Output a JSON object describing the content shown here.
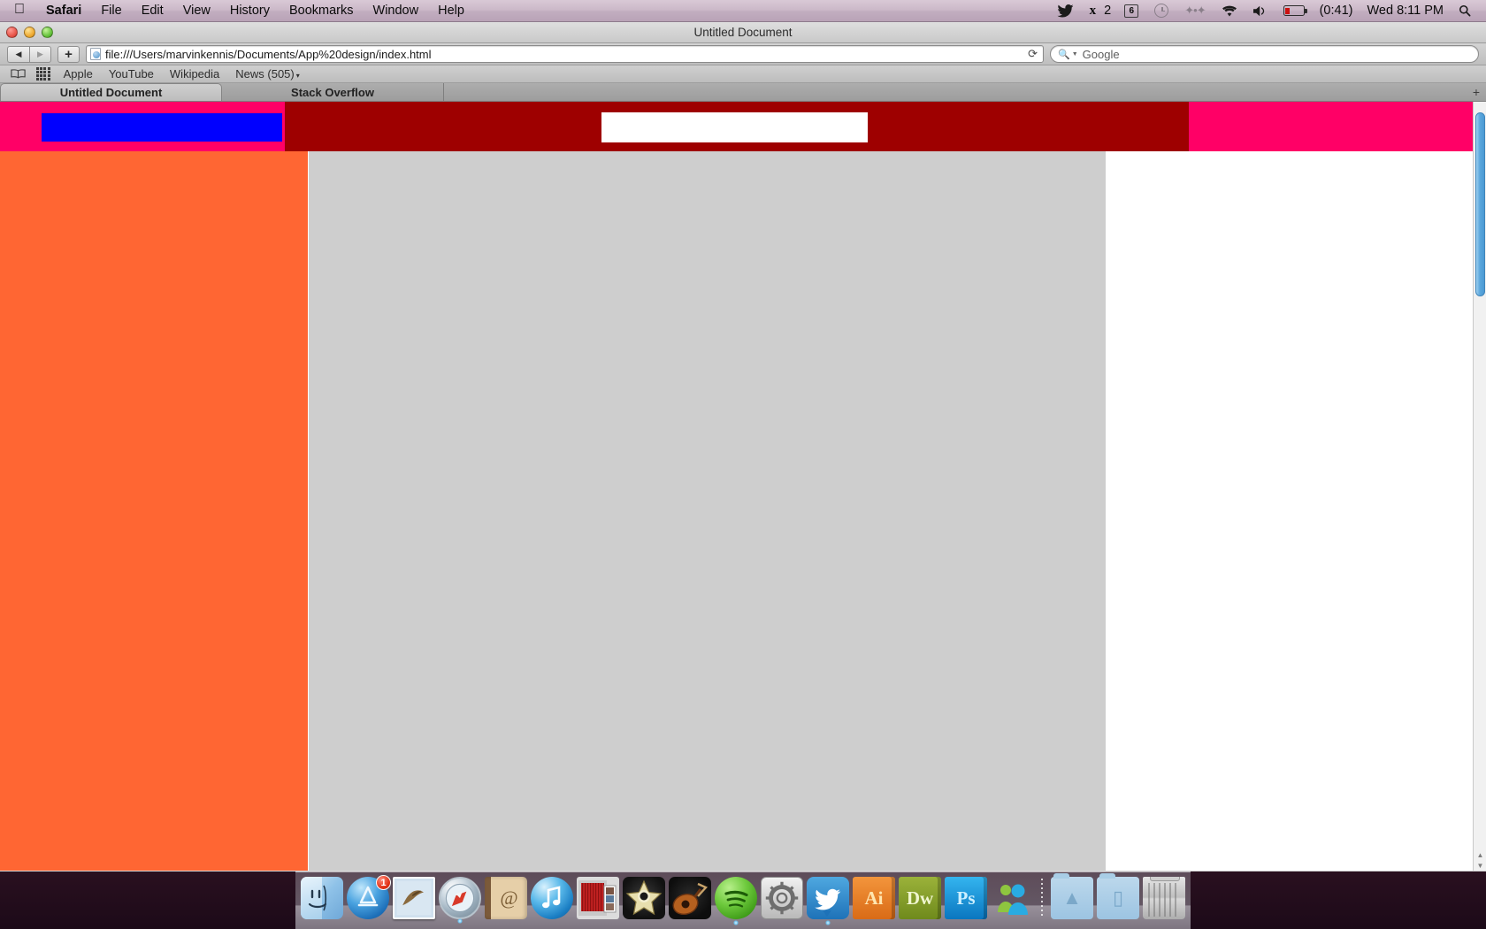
{
  "menubar": {
    "apple_icon": "apple-logo-icon",
    "app_name": "Safari",
    "items": [
      "File",
      "Edit",
      "View",
      "History",
      "Bookmarks",
      "Window",
      "Help"
    ],
    "status": {
      "twitter_icon": "twitter-bird-icon",
      "adobe_icon": "adobe-cc-icon",
      "adobe_count": "2",
      "spaces_icon": "spaces-number-icon",
      "spaces_number": "6",
      "timemachine_icon": "time-machine-clock-icon",
      "bluetooth_icon": "bluetooth-icon",
      "wifi_icon": "wifi-icon",
      "volume_icon": "volume-speaker-icon",
      "battery_icon": "battery-icon",
      "battery_time": "(0:41)",
      "clock": "Wed 8:11 PM",
      "spotlight_icon": "spotlight-search-icon"
    }
  },
  "window": {
    "title": "Untitled Document",
    "traffic_lights": [
      "close-button",
      "minimize-button",
      "zoom-button"
    ]
  },
  "toolbar": {
    "back_icon": "back-arrow-icon",
    "forward_icon": "forward-arrow-icon",
    "add_bookmark_icon": "plus-icon",
    "page_icon": "page-favicon-icon",
    "url": "file:///Users/marvinkennis/Documents/App%20design/index.html",
    "reload_icon": "reload-icon",
    "search_icon": "search-magnifier-icon",
    "search_caret_icon": "chevron-down-icon",
    "search_placeholder": "Google",
    "search_value": ""
  },
  "bookmarks_bar": {
    "show_all_icon": "book-icon",
    "top_sites_icon": "grid-icon",
    "items": [
      {
        "label": "Apple",
        "has_caret": false
      },
      {
        "label": "YouTube",
        "has_caret": false
      },
      {
        "label": "Wikipedia",
        "has_caret": false
      },
      {
        "label": "News (505)",
        "has_caret": true
      }
    ],
    "caret": "▾"
  },
  "tabs": {
    "items": [
      {
        "label": "Untitled Document",
        "active": true
      },
      {
        "label": "Stack Overflow",
        "active": false
      }
    ],
    "new_tab_label": "+"
  },
  "page": {
    "header_band_color": "#ff0066",
    "header_dark_color": "#9e0000",
    "header_blue_block_color": "#0000ff",
    "header_input_value": "",
    "sidebar_color": "#ff6633",
    "content_color": "#cecece",
    "right_column_color": "#ffffff"
  },
  "scrollbar": {
    "up_arrow": "▲",
    "down_arrow": "▼"
  },
  "dock": {
    "items": [
      {
        "name": "finder",
        "label": "Finder",
        "badge": "",
        "running": true
      },
      {
        "name": "app-store",
        "label": "App Store",
        "badge": "1",
        "running": false
      },
      {
        "name": "mail",
        "label": "Mail",
        "badge": "",
        "running": false
      },
      {
        "name": "safari",
        "label": "Safari",
        "badge": "",
        "running": true
      },
      {
        "name": "address-book",
        "label": "Address Book",
        "badge": "",
        "running": false
      },
      {
        "name": "itunes",
        "label": "iTunes",
        "badge": "",
        "running": false
      },
      {
        "name": "photo-booth",
        "label": "Photo Booth",
        "badge": "",
        "running": false
      },
      {
        "name": "imovie",
        "label": "iMovie",
        "badge": "",
        "running": false
      },
      {
        "name": "garageband",
        "label": "GarageBand",
        "badge": "",
        "running": false
      },
      {
        "name": "spotify",
        "label": "Spotify",
        "badge": "",
        "running": true
      },
      {
        "name": "system-preferences",
        "label": "System Preferences",
        "badge": "",
        "running": false
      },
      {
        "name": "twitter",
        "label": "Twitter",
        "badge": "",
        "running": true
      },
      {
        "name": "illustrator",
        "label": "Ai",
        "badge": "",
        "running": false
      },
      {
        "name": "dreamweaver",
        "label": "Dw",
        "badge": "",
        "running": true
      },
      {
        "name": "photoshop",
        "label": "Ps",
        "badge": "",
        "running": false
      },
      {
        "name": "messenger",
        "label": "Messenger",
        "badge": "",
        "running": false
      }
    ],
    "stacks": [
      {
        "name": "applications-folder",
        "label": "Applications"
      },
      {
        "name": "documents-folder",
        "label": "Documents"
      }
    ],
    "trash": {
      "name": "trash",
      "label": "Trash"
    }
  }
}
